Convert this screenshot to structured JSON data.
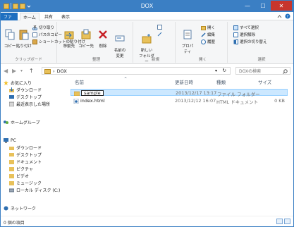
{
  "window": {
    "title": "DOX"
  },
  "tabs": [
    "ファイル",
    "ホーム",
    "共有",
    "表示"
  ],
  "ribbon": {
    "clipboard": {
      "copy": "コピー",
      "paste": "貼り付け",
      "cut": "切り取り",
      "copy_path": "パスのコピー",
      "paste_shortcut": "ショートカットの貼り付け",
      "label": "クリップボード"
    },
    "organize": {
      "move": "移動先",
      "copy_to": "コピー先",
      "delete": "削除",
      "rename": "名前の\n変更",
      "label": "整理"
    },
    "new": {
      "new_folder": "新しい\nフォルダー",
      "label": "新規"
    },
    "open": {
      "properties": "プロパティ",
      "open": "開く",
      "edit": "編集",
      "history": "履歴",
      "label": "開く"
    },
    "select": {
      "select_all": "すべて選択",
      "select_none": "選択解除",
      "invert": "選択の切り替え",
      "label": "選択"
    }
  },
  "address": {
    "path": "DOX",
    "search_placeholder": "DOXの検索"
  },
  "nav": {
    "favorites": "お気に入り",
    "fav_items": [
      "ダウンロード",
      "デスクトップ",
      "最近表示した場所"
    ],
    "homegroup": "ホームグループ",
    "pc": "PC",
    "pc_items": [
      "ダウンロード",
      "デスクトップ",
      "ドキュメント",
      "ピクチャ",
      "ビデオ",
      "ミュージック",
      "ローカル ディスク (C:)"
    ],
    "network": "ネットワーク"
  },
  "columns": {
    "name": "名前",
    "date": "更新日時",
    "type": "種類",
    "size": "サイズ"
  },
  "files": [
    {
      "name": "sample",
      "date": "2013/12/17 13:17",
      "type": "ファイル フォルダー",
      "size": ""
    },
    {
      "name": "index.html",
      "date": "2013/12/12 16:07",
      "type": "HTML ドキュメント",
      "size": "0 KB"
    }
  ],
  "status": {
    "text": "0 個の項目"
  }
}
